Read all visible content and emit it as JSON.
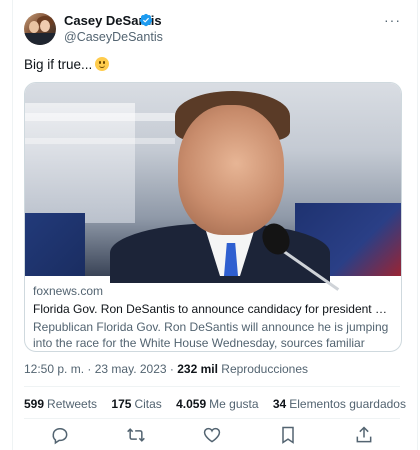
{
  "author": {
    "display_name": "Casey DeSantis",
    "handle": "@CaseyDeSantis",
    "avatar_icon": "avatar-photo",
    "verified_icon": "verified-badge-icon",
    "verified_color": "#1d9bf0"
  },
  "more_icon": "more-options-icon",
  "tweet": {
    "text": "Big if true...",
    "emoji": "slightly-smiling-face-emoji"
  },
  "link_card": {
    "domain": "foxnews.com",
    "title": "Florida Gov. Ron DeSantis to announce candidacy for president Wednesday o...",
    "description": "Republican Florida Gov. Ron DeSantis will announce he is jumping into the race for the White House Wednesday, sources familiar confirm to Fox News."
  },
  "meta": {
    "time": "12:50 p. m.",
    "separator": "·",
    "date": "23 may. 2023",
    "views_count": "232 mil",
    "views_label": "Reproducciones"
  },
  "stats": {
    "retweets_count": "599",
    "retweets_label": "Retweets",
    "quotes_count": "175",
    "quotes_label": "Citas",
    "likes_count": "4.059",
    "likes_label": "Me gusta",
    "bookmarks_count": "34",
    "bookmarks_label": "Elementos guardados"
  },
  "actions": [
    "reply-icon",
    "retweet-icon",
    "like-icon",
    "bookmark-icon",
    "share-icon"
  ],
  "colors": {
    "text": "#0f1419",
    "secondary": "#536471",
    "border": "#cfd9de",
    "accent": "#1d9bf0"
  }
}
